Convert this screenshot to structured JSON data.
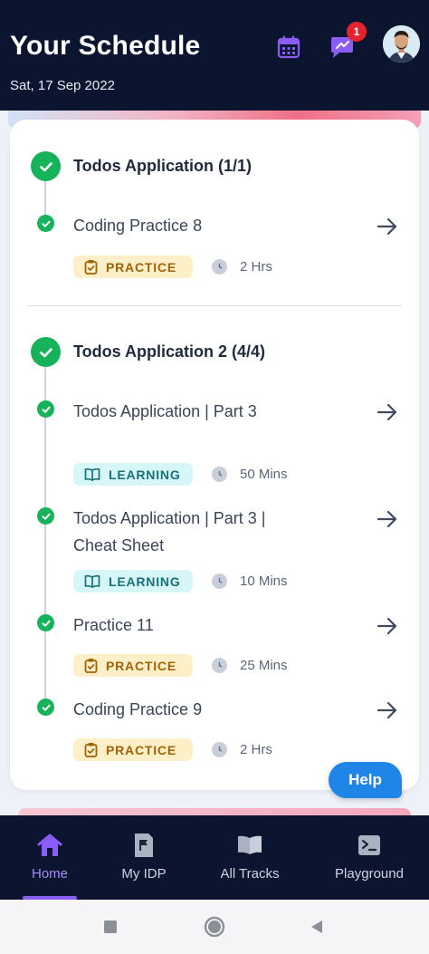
{
  "header": {
    "title": "Your Schedule",
    "date": "Sat, 17 Sep 2022",
    "notification_count": "1",
    "icons": [
      "calendar-icon",
      "chat-icon",
      "avatar"
    ]
  },
  "sections": [
    {
      "title": "Todos Application (1/1)",
      "items": [
        {
          "title": "Coding Practice 8",
          "tag": "PRACTICE",
          "duration": "2 Hrs"
        }
      ]
    },
    {
      "title": "Todos Application 2 (4/4)",
      "items": [
        {
          "title": "Todos Application | Part 3",
          "tag": "LEARNING",
          "duration": "50 Mins"
        },
        {
          "title": "Todos Application | Part 3 | Cheat Sheet",
          "tag": "LEARNING",
          "duration": "10 Mins"
        },
        {
          "title": "Practice 11",
          "tag": "PRACTICE",
          "duration": "25 Mins"
        },
        {
          "title": "Coding Practice 9",
          "tag": "PRACTICE",
          "duration": "2 Hrs"
        }
      ]
    }
  ],
  "help_label": "Help",
  "nav": [
    {
      "label": "Home",
      "icon": "home-icon",
      "active": true
    },
    {
      "label": "My IDP",
      "icon": "flag-document-icon",
      "active": false
    },
    {
      "label": "All Tracks",
      "icon": "open-book-icon",
      "active": false
    },
    {
      "label": "Playground",
      "icon": "terminal-icon",
      "active": false
    }
  ],
  "colors": {
    "header_bg": "#0b1530",
    "accent": "#8b5cf6",
    "success": "#17b35a",
    "practice_bg": "#fdf0c9",
    "practice_fg": "#a16207",
    "learning_bg": "#d7f6f7",
    "learning_fg": "#16717a",
    "help_bg": "#1f86e8",
    "badge": "#e5232f"
  }
}
